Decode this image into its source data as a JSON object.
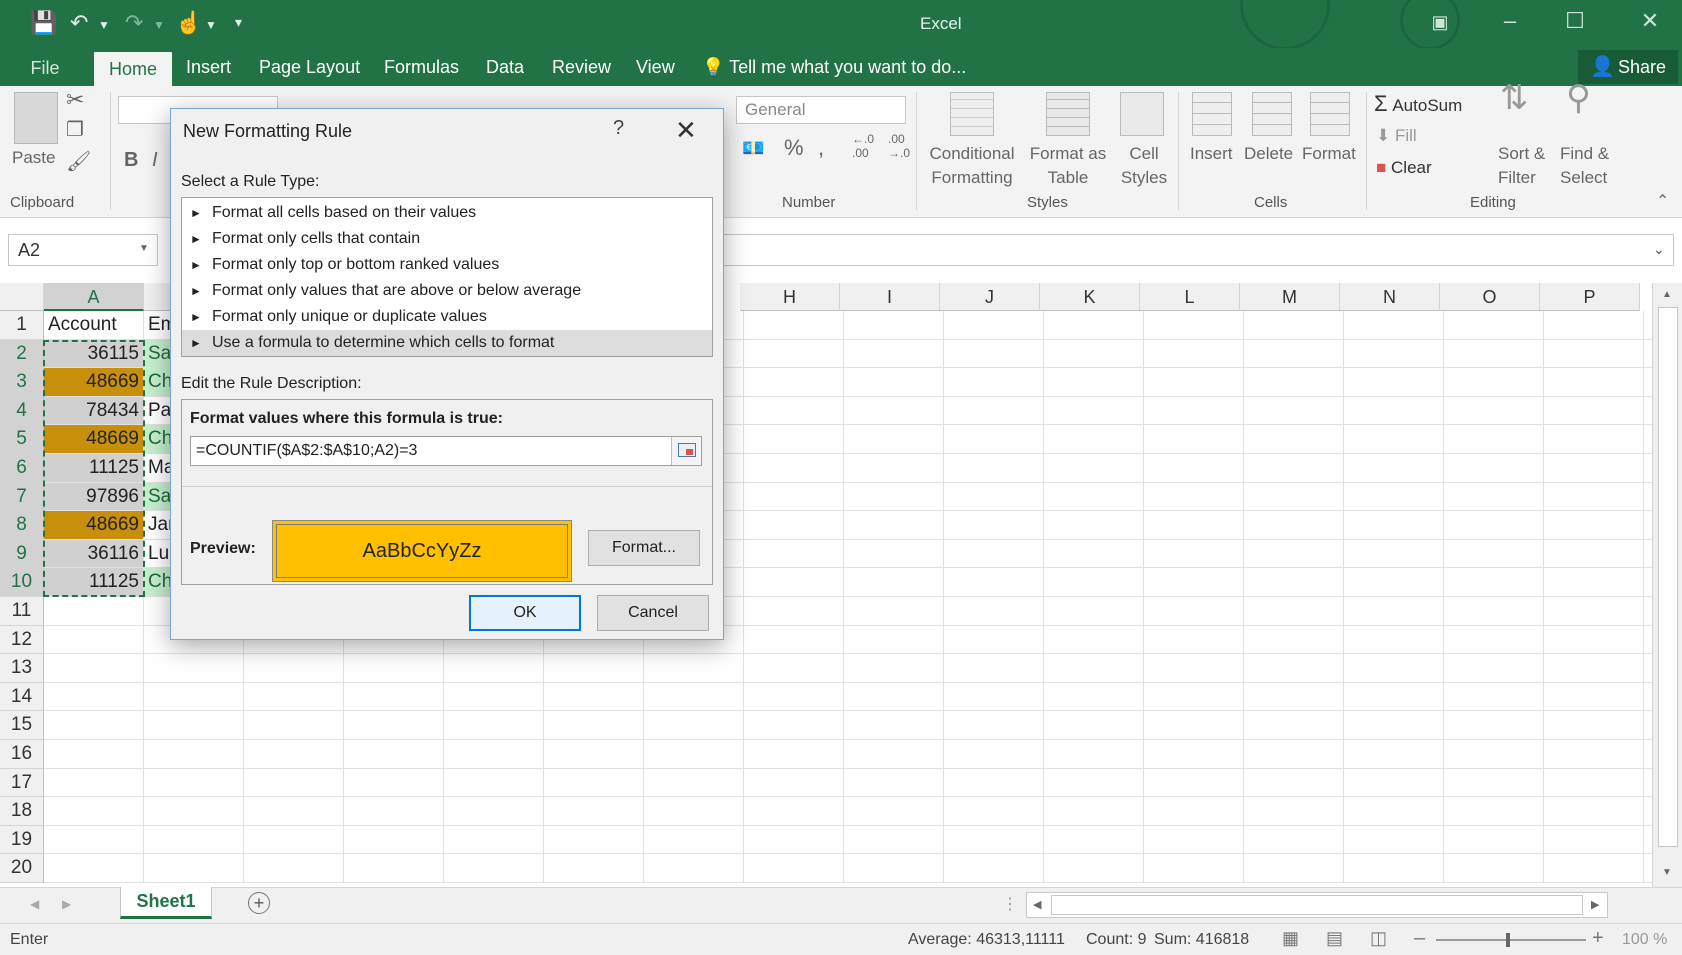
{
  "app": {
    "window_title": "Excel",
    "accent": "#217346"
  },
  "tabs": [
    {
      "label": "File"
    },
    {
      "label": "Home"
    },
    {
      "label": "Insert"
    },
    {
      "label": "Page Layout"
    },
    {
      "label": "Formulas"
    },
    {
      "label": "Data"
    },
    {
      "label": "Review"
    },
    {
      "label": "View"
    }
  ],
  "tell_me": "Tell me what you want to do...",
  "share_label": "Share",
  "ribbon": {
    "paste": "Paste",
    "clipboard": "Clipboard",
    "number_format": "General",
    "number": "Number",
    "conditional_formatting_1": "Conditional",
    "conditional_formatting_2": "Formatting",
    "format_as_table_1": "Format as",
    "format_as_table_2": "Table",
    "cell_styles_1": "Cell",
    "cell_styles_2": "Styles",
    "styles": "Styles",
    "insert": "Insert",
    "delete": "Delete",
    "format": "Format",
    "cells": "Cells",
    "autosum": "AutoSum",
    "fill": "Fill",
    "clear": "Clear",
    "sort_filter_1": "Sort &",
    "sort_filter_2": "Filter",
    "find_select_1": "Find &",
    "find_select_2": "Select",
    "editing": "Editing"
  },
  "name_box": "A2",
  "grid": {
    "columns_left": [
      "A"
    ],
    "columns_right": [
      "H",
      "I",
      "J",
      "K",
      "L",
      "M",
      "N",
      "O",
      "P"
    ],
    "rows": [
      "1",
      "2",
      "3",
      "4",
      "5",
      "6",
      "7",
      "8",
      "9",
      "10",
      "11",
      "12",
      "13",
      "14",
      "15",
      "16",
      "17",
      "18",
      "19",
      "20"
    ],
    "header_a": "Account",
    "header_b": "Em",
    "col_a": [
      "36115",
      "48669",
      "78434",
      "48669",
      "11125",
      "97896",
      "48669",
      "36116",
      "11125"
    ],
    "col_b": [
      "Sa",
      "Ch",
      "Pa",
      "Ch",
      "Ma",
      "Sa",
      "Jar",
      "Lu",
      "Ch"
    ],
    "col_a_fill": [
      "#d0d0d0",
      "#c8900a",
      "#d0d0d0",
      "#c8900a",
      "#d0d0d0",
      "#d0d0d0",
      "#c8900a",
      "#d0d0d0",
      "#d0d0d0"
    ],
    "col_b_fill": [
      "#c6efce",
      "#c6efce",
      "#ffffff",
      "#c6efce",
      "#ffffff",
      "#c6efce",
      "#ffffff",
      "#ffffff",
      "#c6efce"
    ]
  },
  "sheet_tab": "Sheet1",
  "status": {
    "mode": "Enter",
    "average": "Average: 46313,11111",
    "count": "Count: 9",
    "sum": "Sum: 416818",
    "zoom": "100 %"
  },
  "dialog": {
    "title": "New Formatting Rule",
    "help": "?",
    "select_rule_type_label": "Select a Rule Type:",
    "rule_types": [
      "Format all cells based on their values",
      "Format only cells that contain",
      "Format only top or bottom ranked values",
      "Format only values that are above or below average",
      "Format only unique or duplicate values",
      "Use a formula to determine which cells to format"
    ],
    "edit_desc_label": "Edit the Rule Description:",
    "formula_label": "Format values where this formula is true:",
    "formula_value": "=COUNTIF($A$2:$A$10;A2)=3",
    "preview_label": "Preview:",
    "preview_text": "AaBbCcYyZz",
    "preview_color": "#ffc000",
    "format_button": "Format...",
    "ok_button": "OK",
    "cancel_button": "Cancel"
  }
}
